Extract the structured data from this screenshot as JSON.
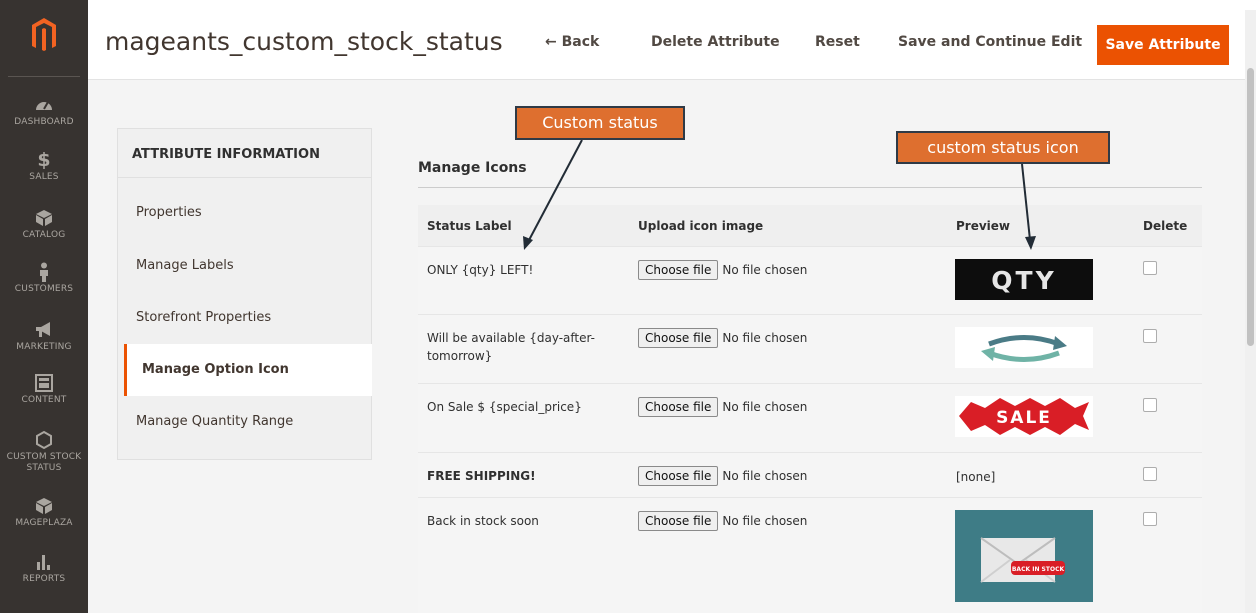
{
  "nav": {
    "items": [
      {
        "label": "DASHBOARD",
        "icon": "dashboard-gauge-icon"
      },
      {
        "label": "SALES",
        "icon": "dollar-icon"
      },
      {
        "label": "CATALOG",
        "icon": "box-icon"
      },
      {
        "label": "CUSTOMERS",
        "icon": "person-icon"
      },
      {
        "label": "MARKETING",
        "icon": "megaphone-icon"
      },
      {
        "label": "CONTENT",
        "icon": "layout-icon"
      },
      {
        "label": "CUSTOM STOCK",
        "label2": "STATUS",
        "icon": "hexagon-icon"
      },
      {
        "label": "MAGEPLAZA",
        "icon": "box-icon"
      },
      {
        "label": "REPORTS",
        "icon": "bar-chart-icon"
      }
    ]
  },
  "header": {
    "title": "mageants_custom_stock_status",
    "back": "← Back",
    "delete": "Delete Attribute",
    "reset": "Reset",
    "save_continue": "Save and Continue Edit",
    "save": "Save Attribute"
  },
  "tabs": {
    "heading": "ATTRIBUTE INFORMATION",
    "items": [
      "Properties",
      "Manage Labels",
      "Storefront Properties",
      "Manage Option Icon",
      "Manage Quantity Range"
    ]
  },
  "section": {
    "title": "Manage Icons"
  },
  "grid": {
    "columns": [
      "Status Label",
      "Upload icon image",
      "Preview",
      "Delete"
    ],
    "choose_label": "Choose file",
    "no_file": "No file chosen",
    "rows": [
      {
        "label": "ONLY {qty} LEFT!",
        "preview": "QTY"
      },
      {
        "label": "Will be available {day-after-tomorrow}",
        "preview": ""
      },
      {
        "label": "On Sale $ {special_price}",
        "preview": "SALE"
      },
      {
        "label": "FREE SHIPPING!",
        "preview": "[none]"
      },
      {
        "label": "Back in stock soon",
        "preview": "BACK IN STOCK"
      }
    ]
  },
  "annotations": {
    "custom_status": "Custom status",
    "custom_status_icon": "custom status icon"
  },
  "colors": {
    "accent": "#eb5202",
    "nav_bg": "#373330",
    "callout": "#de6f2f"
  }
}
